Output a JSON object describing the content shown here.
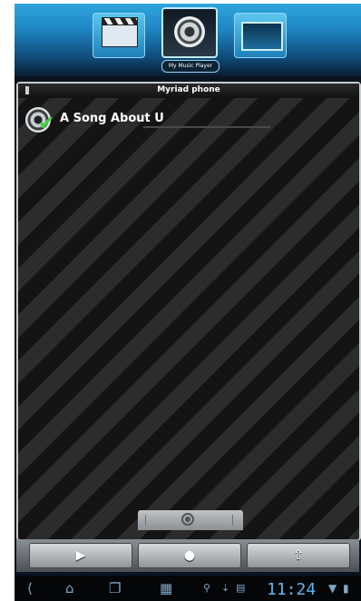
{
  "top_switcher": {
    "apps": [
      {
        "name": "video",
        "icon": "video-clapper-icon"
      },
      {
        "name": "music",
        "icon": "speaker-icon",
        "selected": true
      },
      {
        "name": "tv",
        "icon": "tv-icon"
      }
    ],
    "selected_caption": "My Music Player"
  },
  "panel": {
    "title": "Myriad phone",
    "songs": [
      {
        "title": "A Song About U",
        "icon": "speaker-icon",
        "status_icon": "check-icon"
      }
    ]
  },
  "drawer_handle": {
    "icon": "record-icon"
  },
  "controls": {
    "play_icon": "▶",
    "stop_icon": "●",
    "share_icon": "⇧"
  },
  "system_bar": {
    "back_icon": "back-icon",
    "home_icon": "home-icon",
    "recent_icon": "recent-apps-icon",
    "clock": "11:24"
  },
  "colors": {
    "accent_blue": "#1f86c3",
    "check_green": "#3fd23f"
  }
}
